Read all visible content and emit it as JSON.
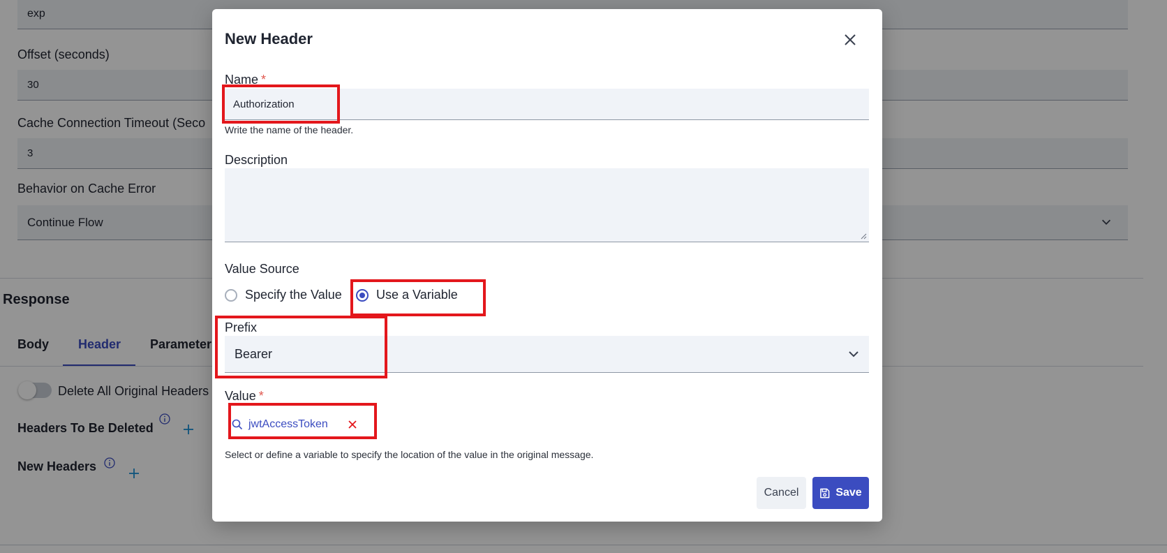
{
  "background": {
    "field_top_value": "exp",
    "offset_label": "Offset (seconds)",
    "offset_value": "30",
    "cache_timeout_label": "Cache Connection Timeout (Seco",
    "cache_timeout_value": "3",
    "cache_error_label": "Behavior on Cache Error",
    "cache_error_value": "Continue Flow",
    "section_title": "Response",
    "tabs": [
      {
        "label": "Body"
      },
      {
        "label": "Header"
      },
      {
        "label": "Parameter"
      }
    ],
    "toggle_label": "Delete All Original Headers",
    "headers_deleted_label": "Headers To Be Deleted",
    "new_headers_label": "New Headers"
  },
  "modal": {
    "title": "New Header",
    "name_label": "Name",
    "required_mark": "*",
    "name_value": "Authorization",
    "name_help": "Write the name of the header.",
    "description_label": "Description",
    "description_value": "",
    "value_source_label": "Value Source",
    "radio_specify": "Specify the Value",
    "radio_variable": "Use a Variable",
    "prefix_label": "Prefix",
    "prefix_value": "Bearer",
    "value_label": "Value",
    "value_variable": "jwtAccessToken",
    "value_help": "Select or define a variable to specify the location of the value in the original message.",
    "cancel_label": "Cancel",
    "save_label": "Save"
  },
  "colors": {
    "accent": "#3b4cc0",
    "required": "#e0584f",
    "highlight": "#e3171c",
    "clear_icon": "#e3171c"
  }
}
